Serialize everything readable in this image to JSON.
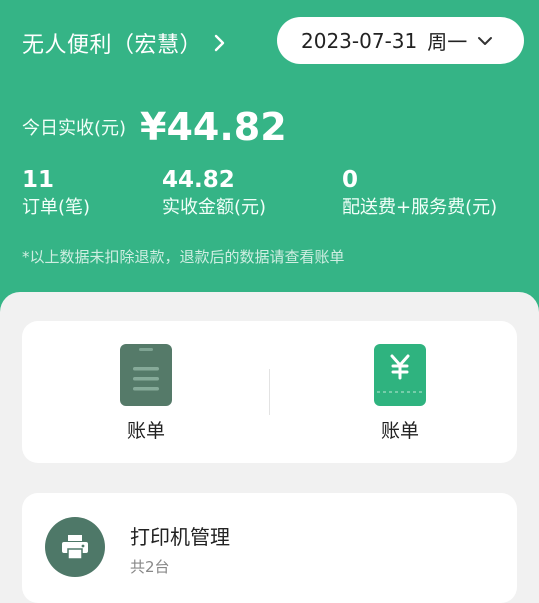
{
  "header": {
    "store_name": "无人便利（宏慧）",
    "date": "2023-07-31",
    "weekday": "周一"
  },
  "today": {
    "label": "今日实收(元)",
    "amount": "¥44.82"
  },
  "stats": [
    {
      "value": "11",
      "label": "订单(笔)"
    },
    {
      "value": "44.82",
      "label": "实收金额(元)"
    },
    {
      "value": "0",
      "label": "配送费+服务费(元)"
    }
  ],
  "note": "*以上数据未扣除退款，退款后的数据请查看账单",
  "bills": [
    {
      "label": "账单",
      "icon": "document-icon"
    },
    {
      "label": "账单",
      "icon": "yen-bill-icon"
    }
  ],
  "printer": {
    "title": "打印机管理",
    "subtitle": "共2台",
    "icon": "printer-icon"
  },
  "colors": {
    "brand_green": "#35b486",
    "doc_icon": "#557a69",
    "yen_icon": "#2fb37f",
    "printer_circle": "#4e7868"
  }
}
